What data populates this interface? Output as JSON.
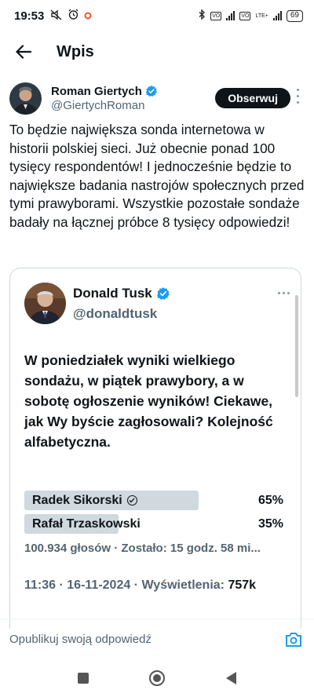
{
  "status_bar": {
    "time": "19:53",
    "lte_label": "LTE+",
    "battery": "69"
  },
  "header": {
    "title": "Wpis"
  },
  "post": {
    "author_name": "Roman Giertych",
    "author_handle": "@GiertychRoman",
    "follow_label": "Obserwuj",
    "text": "To będzie największa sonda internetowa w historii polskiej sieci. Już obecnie ponad 100 tysięcy respondentów! I jednocześnie będzie to największe badania nastrojów społecznych przed tymi prawyborami. Wszystkie pozostałe sondaże badały na łącznej próbce 8 tysięcy odpowiedzi!"
  },
  "quote": {
    "author_name": "Donald Tusk",
    "author_handle": "@donaldtusk",
    "text": "W poniedziałek wyniki wielkiego sondażu, w piątek prawybory, a w sobotę ogłoszenie wyników! Ciekawe, jak Wy byście zagłosowali? Kolejność alfabetyczna.",
    "poll": {
      "options": [
        {
          "label": "Radek Sikorski",
          "percent_label": "65%",
          "share": 0.65,
          "selected": true
        },
        {
          "label": "Rafał Trzaskowski",
          "percent_label": "35%",
          "share": 0.35,
          "selected": false
        }
      ],
      "meta": "100.934 głosów · Zostało: 15 godz. 58 mi..."
    },
    "time": "11:36",
    "date": "16-11-2024",
    "views_label": "Wyświetlenia:",
    "views": "757k"
  },
  "reply": {
    "placeholder": "Opublikuj swoją odpowiedź"
  },
  "colors": {
    "verified": "#1d9bf0",
    "poll_fill": "#cfd9de",
    "follow_bg": "#0f1419",
    "secondary_text": "#536471"
  },
  "icons": [
    "back-arrow-icon",
    "verified-badge-icon",
    "more-vert-icon",
    "more-horiz-icon",
    "check-circle-icon",
    "camera-icon",
    "nav-square-icon",
    "nav-home-icon",
    "nav-back-icon"
  ]
}
